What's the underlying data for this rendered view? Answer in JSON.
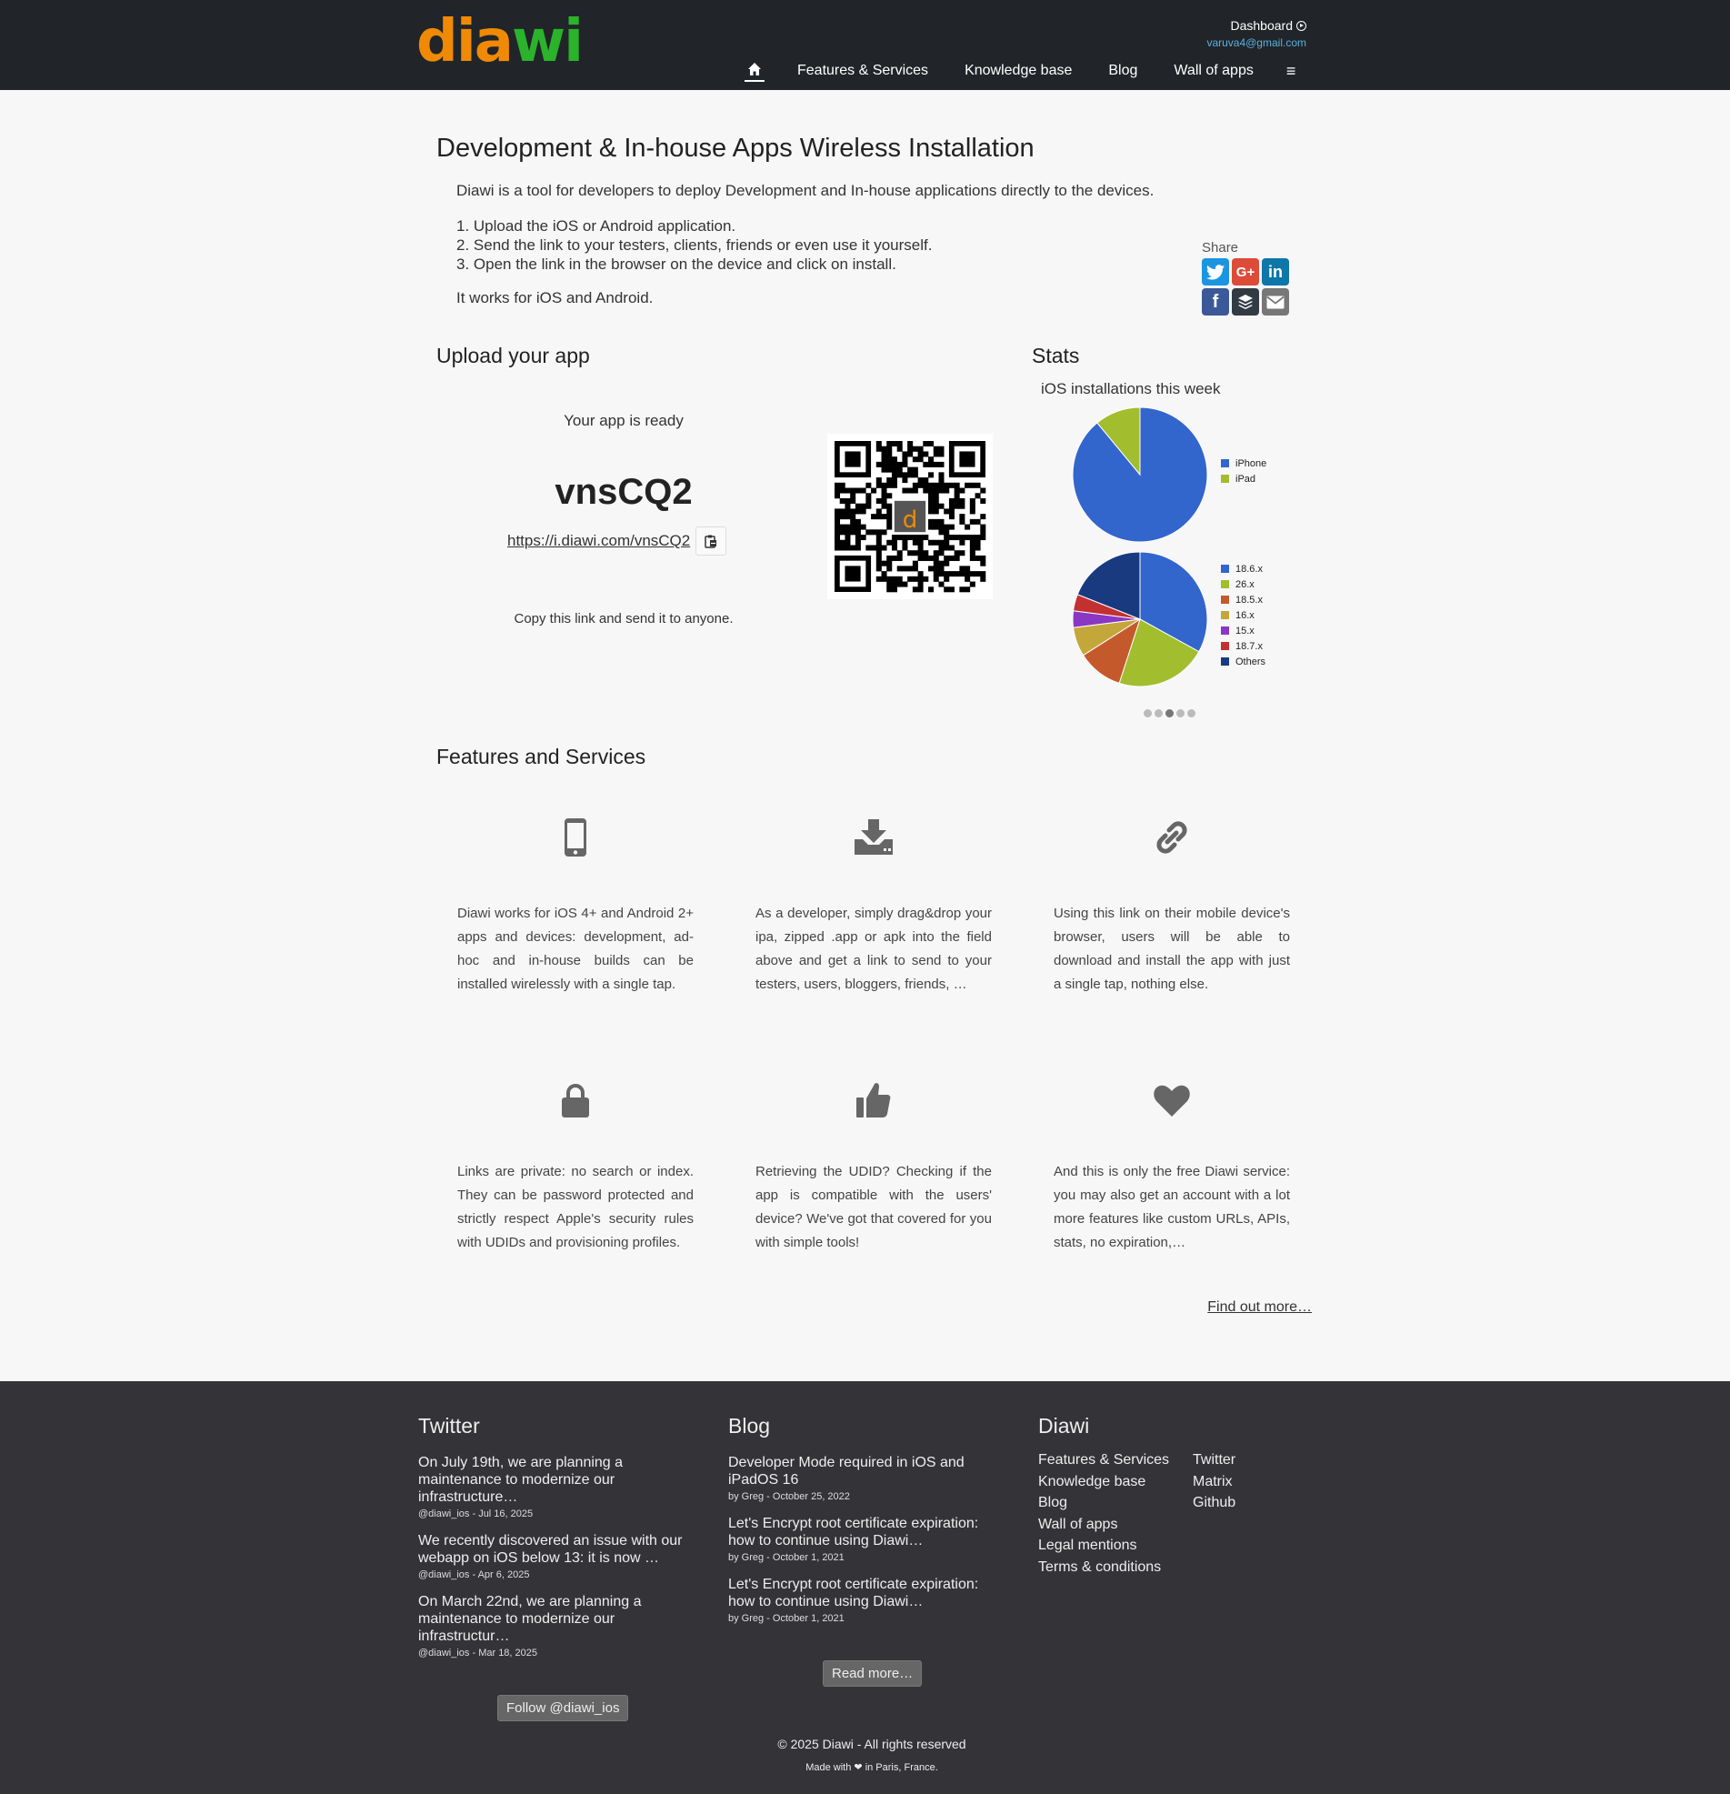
{
  "header": {
    "logo_part1": "dia",
    "logo_part2": "wi",
    "dashboard_label": "Dashboard",
    "user_email": "varuva4@gmail.com",
    "nav": [
      "Features & Services",
      "Knowledge base",
      "Blog",
      "Wall of apps"
    ]
  },
  "intro": {
    "title": "Development & In-house Apps Wireless Installation",
    "description": "Diawi is a tool for developers to deploy Development and In-house applications directly to the devices.",
    "steps": [
      "1. Upload the iOS or Android application.",
      "2. Send the link to your testers, clients, friends or even use it yourself.",
      "3. Open the link in the browser on the device and click on install."
    ],
    "platforms": "It works for iOS and Android."
  },
  "share": {
    "label": "Share",
    "buttons": [
      {
        "icon": "twitter-icon",
        "color": "#1b95e0"
      },
      {
        "icon": "google-plus-icon",
        "color": "#dd4b39"
      },
      {
        "icon": "linkedin-icon",
        "color": "#0e76a8"
      },
      {
        "icon": "facebook-icon",
        "color": "#3b5998"
      },
      {
        "icon": "buffer-icon",
        "color": "#323b43"
      },
      {
        "icon": "email-icon",
        "color": "#777777"
      }
    ]
  },
  "upload": {
    "heading": "Upload your app",
    "ready_text": "Your app is ready",
    "code": "vnsCQ2",
    "link": "https://i.diawi.com/vnsCQ2",
    "copy_hint": "Copy this link and send it to anyone."
  },
  "stats": {
    "heading": "Stats",
    "chart_title": "iOS installations this week",
    "carousel_pages": 5,
    "carousel_active": 3
  },
  "chart_data": [
    {
      "type": "pie",
      "title": "iOS installations this week",
      "categories": [
        "iPhone",
        "iPad"
      ],
      "values": [
        89,
        11
      ],
      "colors": [
        "#3366cc",
        "#a2bd2e"
      ],
      "legend": "right"
    },
    {
      "type": "pie",
      "categories": [
        "18.6.x",
        "26.x",
        "18.5.x",
        "16.x",
        "15.x",
        "18.7.x",
        "Others"
      ],
      "values": [
        33,
        22,
        11,
        7,
        4,
        4,
        19
      ],
      "colors": [
        "#3366cc",
        "#a2bd2e",
        "#c45a2c",
        "#c4a73a",
        "#8a37c4",
        "#c23030",
        "#1a3a80"
      ],
      "legend": "right"
    }
  ],
  "features": {
    "heading": "Features and Services",
    "items": [
      {
        "icon": "smartphone-icon",
        "text": "Diawi works for iOS 4+ and Android 2+ apps and devices: development, ad-hoc and in-house builds can be installed wirelessly with a single tap."
      },
      {
        "icon": "download-tray-icon",
        "text": "As a developer, simply drag&drop your ipa, zipped .app or apk into the field above and get a link to send to your testers, users, bloggers, friends, …"
      },
      {
        "icon": "link-icon",
        "text": "Using this link on their mobile device's browser, users will be able to download and install the app with just a single tap, nothing else."
      },
      {
        "icon": "lock-icon",
        "text": "Links are private: no search or index. They can be password protected and strictly respect Apple's security rules with UDIDs and provisioning profiles."
      },
      {
        "icon": "thumbs-up-icon",
        "text": "Retrieving the UDID? Checking if the app is compatible with the users' device? We've got that covered for you with simple tools!"
      },
      {
        "icon": "heart-icon",
        "text": "And this is only the free Diawi service: you may also get an account with a lot more features like custom URLs, APIs, stats, no expiration,…"
      }
    ],
    "find_more": "Find out more…"
  },
  "footer": {
    "twitter": {
      "heading": "Twitter",
      "items": [
        {
          "text": "On July 19th, we are planning a maintenance to modernize our infrastructure…",
          "meta": "@diawi_ios - Jul 16, 2025"
        },
        {
          "text": "We recently discovered an issue with our webapp on iOS below 13: it is now …",
          "meta": "@diawi_ios - Apr 6, 2025"
        },
        {
          "text": "On March 22nd, we are planning a maintenance to modernize our infrastructur…",
          "meta": "@diawi_ios - Mar 18, 2025"
        }
      ],
      "follow_label": "Follow @diawi_ios"
    },
    "blog": {
      "heading": "Blog",
      "items": [
        {
          "text": "Developer Mode required in iOS and iPadOS 16",
          "meta": "by Greg - October 25, 2022"
        },
        {
          "text": "Let's Encrypt root certificate expiration: how to continue using Diawi…",
          "meta": "by Greg - October 1, 2021"
        },
        {
          "text": "Let's Encrypt root certificate expiration: how to continue using Diawi…",
          "meta": "by Greg - October 1, 2021"
        }
      ],
      "read_more": "Read more…"
    },
    "diawi": {
      "heading": "Diawi",
      "links_col1": [
        "Features & Services",
        "Knowledge base",
        "Blog",
        "Wall of apps",
        "Legal mentions",
        "Terms & conditions"
      ],
      "links_col2": [
        "Twitter",
        "Matrix",
        "Github"
      ]
    },
    "copyright": "© 2025 Diawi - All rights reserved",
    "made_with_prefix": "Made with",
    "made_with_suffix": "in Paris, France."
  }
}
